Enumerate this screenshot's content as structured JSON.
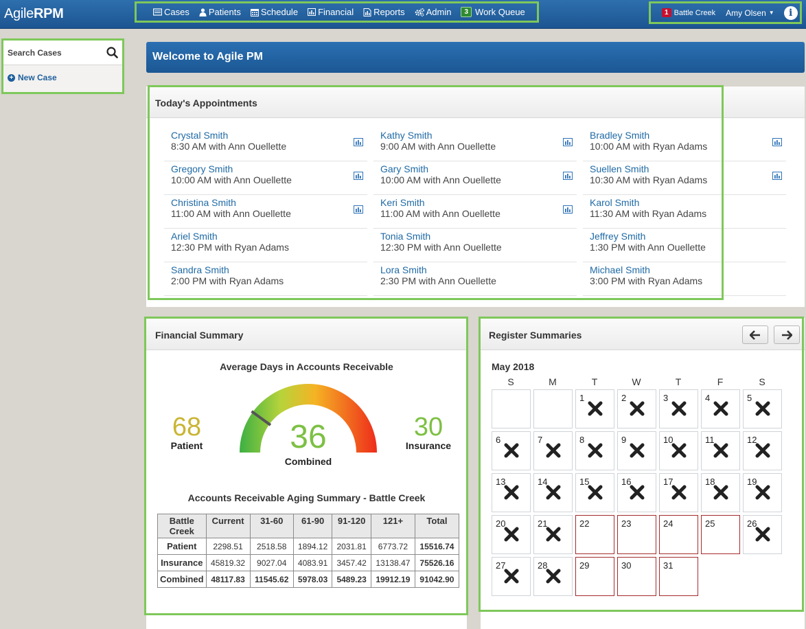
{
  "app": {
    "logo_light": "Agile",
    "logo_bold": "RPM"
  },
  "nav": [
    {
      "label": "Cases",
      "icon": "cases-icon"
    },
    {
      "label": "Patients",
      "icon": "patients-icon"
    },
    {
      "label": "Schedule",
      "icon": "calendar-icon"
    },
    {
      "label": "Financial",
      "icon": "bar-chart-icon"
    },
    {
      "label": "Reports",
      "icon": "reports-icon"
    },
    {
      "label": "Admin",
      "icon": "gears-icon"
    },
    {
      "label": "Work Queue",
      "icon": "work-queue-badge",
      "badge": "3"
    }
  ],
  "user": {
    "location_badge": "1",
    "location": "Battle Creek",
    "name": "Amy Olsen"
  },
  "sidebar": {
    "search_label": "Search Cases",
    "new_case": "New Case"
  },
  "welcome": "Welcome to Agile PM",
  "appointments": {
    "title": "Today's Appointments",
    "columns": [
      [
        {
          "name": "Crystal Smith",
          "time": "8:30 AM with Ann Ouellette",
          "chart": true
        },
        {
          "name": "Gregory Smith",
          "time": "10:00 AM with Ann Ouellette",
          "chart": true
        },
        {
          "name": "Christina Smith",
          "time": "11:00 AM with Ann Ouellette",
          "chart": true
        },
        {
          "name": "Ariel Smith",
          "time": "12:30 PM with Ryan Adams",
          "chart": false
        },
        {
          "name": "Sandra Smith",
          "time": "2:00 PM with Ryan Adams",
          "chart": false
        }
      ],
      [
        {
          "name": "Kathy Smith",
          "time": "9:00 AM with Ann Ouellette",
          "chart": true
        },
        {
          "name": "Gary Smith",
          "time": "10:00 AM with Ann Ouellette",
          "chart": true
        },
        {
          "name": "Keri Smith",
          "time": "11:00 AM with Ann Ouellette",
          "chart": true
        },
        {
          "name": "Tonia Smith",
          "time": "12:30 PM with Ann Ouellette",
          "chart": false
        },
        {
          "name": "Lora Smith",
          "time": "2:30 PM with Ann Ouellette",
          "chart": false
        }
      ],
      [
        {
          "name": "Bradley Smith",
          "time": "10:00 AM with Ryan Adams",
          "chart": true
        },
        {
          "name": "Suellen Smith",
          "time": "10:30 AM with Ryan Adams",
          "chart": true
        },
        {
          "name": "Karol Smith",
          "time": "11:30 AM with Ryan Adams",
          "chart": false
        },
        {
          "name": "Jeffrey Smith",
          "time": "1:30 PM with Ann Ouellette",
          "chart": false
        },
        {
          "name": "Michael Smith",
          "time": "3:00 PM with Ryan Adams",
          "chart": false
        }
      ]
    ]
  },
  "financial": {
    "title": "Financial Summary",
    "gauge_title": "Average Days in Accounts Receivable",
    "patient_value": "68",
    "patient_label": "Patient",
    "combined_value": "36",
    "combined_label": "Combined",
    "insurance_value": "30",
    "insurance_label": "Insurance",
    "gauge_fraction": 0.2,
    "colors": {
      "patient": "#c9b533",
      "combined": "#7dc043",
      "insurance": "#7dc043"
    },
    "aging_title": "Accounts Receivable Aging Summary - Battle Creek",
    "aging_headers": [
      "Battle Creek",
      "Current",
      "31-60",
      "61-90",
      "91-120",
      "121+",
      "Total"
    ],
    "aging_rows": [
      [
        "Patient",
        "2298.51",
        "2518.58",
        "1894.12",
        "2031.81",
        "6773.72",
        "15516.74"
      ],
      [
        "Insurance",
        "45819.32",
        "9027.04",
        "4083.91",
        "3457.42",
        "13138.47",
        "75526.16"
      ],
      [
        "Combined",
        "48117.83",
        "11545.62",
        "5978.03",
        "5489.23",
        "19912.19",
        "91042.90"
      ]
    ]
  },
  "register": {
    "title": "Register Summaries",
    "month": "May 2018",
    "weekdays": [
      "S",
      "M",
      "T",
      "W",
      "T",
      "F",
      "S"
    ],
    "first_weekday": 2,
    "days_in_month": 31,
    "last_completed_day": 21,
    "extra_completed_days": [
      26,
      27,
      28
    ]
  }
}
